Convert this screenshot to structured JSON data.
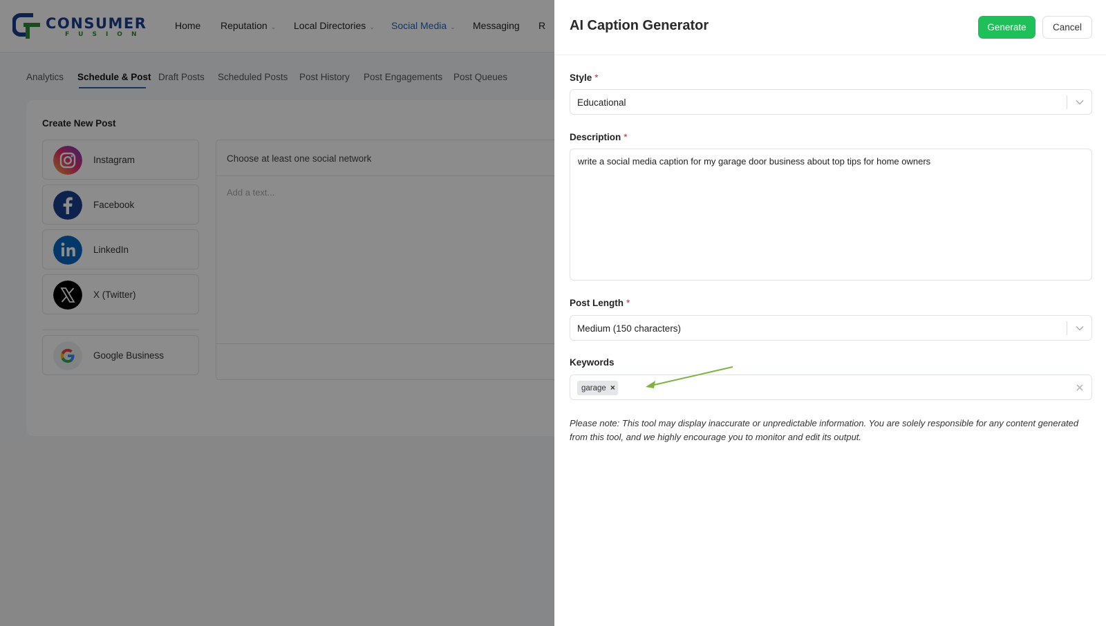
{
  "app": {
    "logo_text": "CONSUMER",
    "logo_sub": "FUSION",
    "nav": [
      {
        "label": "Home"
      },
      {
        "label": "Reputation"
      },
      {
        "label": "Local Directories"
      },
      {
        "label": "Social Media"
      },
      {
        "label": "Messaging"
      },
      {
        "label": "R"
      }
    ],
    "active_nav": "Social Media",
    "subtabs": [
      "Analytics",
      "Schedule & Post",
      "Draft Posts",
      "Scheduled Posts",
      "Post History",
      "Post Engagements",
      "Post Queues"
    ],
    "active_subtab": "Schedule & Post"
  },
  "create_post": {
    "title": "Create New Post",
    "networks": [
      {
        "label": "Instagram",
        "icon": "instagram-icon"
      },
      {
        "label": "Facebook",
        "icon": "facebook-icon"
      },
      {
        "label": "LinkedIn",
        "icon": "linkedin-icon"
      },
      {
        "label": "X (Twitter)",
        "icon": "x-twitter-icon"
      },
      {
        "label": "Google Business",
        "icon": "google-icon"
      }
    ],
    "choose_text": "Choose at least one social network",
    "text_placeholder": "Add a text..."
  },
  "drawer": {
    "title": "AI Caption Generator",
    "generate_label": "Generate",
    "cancel_label": "Cancel",
    "style": {
      "label": "Style",
      "required_mark": "*",
      "value": "Educational"
    },
    "description": {
      "label": "Description",
      "required_mark": "*",
      "value": "write a social media caption for my garage door business about top tips for home owners"
    },
    "post_length": {
      "label": "Post Length",
      "required_mark": "*",
      "value": "Medium (150 characters)"
    },
    "keywords": {
      "label": "Keywords",
      "tags": [
        "garage"
      ],
      "remove_glyph": "×"
    },
    "note": "Please note: This tool may display inaccurate or unpredictable information. You are solely responsible for any content generated from this tool, and we highly encourage you to monitor and edit its output."
  },
  "colors": {
    "accent_green": "#1fbf5a",
    "nav_active_blue": "#1e63c6",
    "required_red": "#e0243a",
    "annotation_arrow": "#7cb342"
  }
}
